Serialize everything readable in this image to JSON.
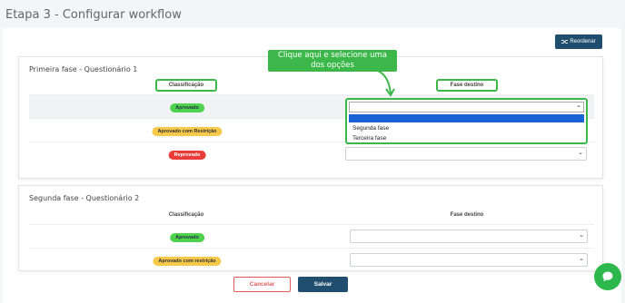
{
  "page": {
    "title": "Etapa 3 - Configurar workflow"
  },
  "toolbar": {
    "reorder_label": "Reordenar",
    "reorder_icon": "shuffle-icon"
  },
  "callout": {
    "line1": "Clique aqui e selecione uma",
    "line2": "dos opções",
    "color": "#3cb84b"
  },
  "phase1": {
    "title": "Primeira fase - Questionário 1",
    "col_classification": "Classificação",
    "col_destination": "Fase destino",
    "rows": [
      {
        "badge": "Aprovado",
        "status": "green"
      },
      {
        "badge": "Aprovado com Restrição",
        "status": "yellow"
      },
      {
        "badge": "Reprovado",
        "status": "red"
      }
    ],
    "dropdown_options": [
      "Segunda fase",
      "Terceira fase"
    ]
  },
  "phase2": {
    "title": "Segunda fase - Questionário 2",
    "col_classification": "Classificação",
    "col_destination": "Fase destino",
    "rows": [
      {
        "badge": "Aprovado",
        "status": "green"
      },
      {
        "badge": "Aprovado com restrição",
        "status": "yellow"
      }
    ]
  },
  "footer": {
    "cancel_label": "Cancelar",
    "save_label": "Salvar"
  },
  "colors": {
    "primary": "#1f4e6e",
    "highlight": "#3cb84b",
    "approved": "#4fd34f",
    "restricted": "#f6c94a",
    "rejected": "#ea3b3b"
  }
}
